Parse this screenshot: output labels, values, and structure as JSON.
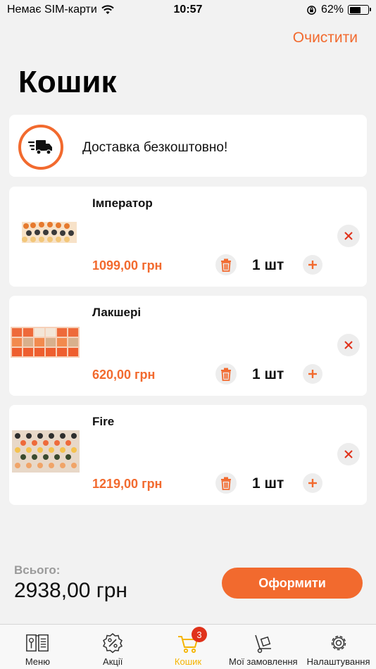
{
  "status_bar": {
    "carrier": "Немає SIM-карти",
    "time": "10:57",
    "battery": "62%",
    "battery_level": 0.62
  },
  "header": {
    "clear_label": "Очистити",
    "title": "Кошик"
  },
  "delivery": {
    "text": "Доставка безкоштовно!",
    "icon": "delivery-truck-icon"
  },
  "cart": {
    "items": [
      {
        "name": "Імператор",
        "price": "1099,00 грн",
        "qty": "1 шт"
      },
      {
        "name": "Лакшері",
        "price": "620,00 грн",
        "qty": "1 шт"
      },
      {
        "name": "Fire",
        "price": "1219,00 грн",
        "qty": "1 шт"
      }
    ]
  },
  "summary": {
    "total_label": "Всього:",
    "total_value": "2938,00 грн",
    "checkout_label": "Оформити"
  },
  "tabs": [
    {
      "label": "Меню",
      "icon": "menu-book-icon"
    },
    {
      "label": "Акції",
      "icon": "percent-badge-icon"
    },
    {
      "label": "Кошик",
      "icon": "cart-icon",
      "badge": "3",
      "active": true
    },
    {
      "label": "Мої замовлення",
      "icon": "hand-truck-icon"
    },
    {
      "label": "Налаштування",
      "icon": "gear-icon"
    }
  ],
  "colors": {
    "accent": "#f26a2e",
    "active_tab": "#f5b400",
    "badge": "#e0321b",
    "background": "#f2f2f2"
  }
}
